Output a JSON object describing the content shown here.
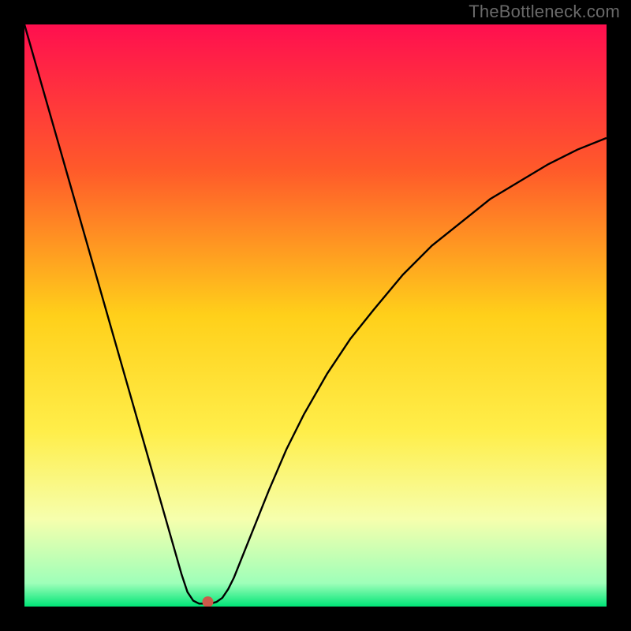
{
  "watermark": "TheBottleneck.com",
  "chart_data": {
    "type": "line",
    "title": "",
    "xlabel": "",
    "ylabel": "",
    "xlim": [
      0,
      100
    ],
    "ylim": [
      0,
      100
    ],
    "grid": false,
    "legend": false,
    "gradient_stops": [
      {
        "offset": 0,
        "color": "#ff0f4f"
      },
      {
        "offset": 25,
        "color": "#ff5a2a"
      },
      {
        "offset": 50,
        "color": "#ffd01a"
      },
      {
        "offset": 70,
        "color": "#ffee4a"
      },
      {
        "offset": 85,
        "color": "#f6ffad"
      },
      {
        "offset": 96,
        "color": "#9effb9"
      },
      {
        "offset": 100,
        "color": "#00e577"
      }
    ],
    "series": [
      {
        "name": "bottleneck-curve",
        "color": "#000000",
        "x": [
          0,
          2,
          4,
          6,
          8,
          10,
          12,
          14,
          16,
          18,
          20,
          22,
          24,
          26,
          27,
          28,
          29,
          30,
          31,
          32,
          33,
          34,
          35,
          36,
          38,
          40,
          42,
          45,
          48,
          52,
          56,
          60,
          65,
          70,
          75,
          80,
          85,
          90,
          95,
          100
        ],
        "y": [
          100,
          93,
          86,
          79,
          72,
          65,
          58,
          51,
          44,
          37,
          30,
          23,
          16,
          9,
          5.5,
          2.5,
          1,
          0.5,
          0.5,
          0.5,
          0.8,
          1.5,
          3,
          5,
          10,
          15,
          20,
          27,
          33,
          40,
          46,
          51,
          57,
          62,
          66,
          70,
          73,
          76,
          78.5,
          80.5
        ]
      }
    ],
    "marker": {
      "x": 31.5,
      "y": 0.8,
      "color": "#cc5a4a",
      "radius_px": 7
    }
  }
}
